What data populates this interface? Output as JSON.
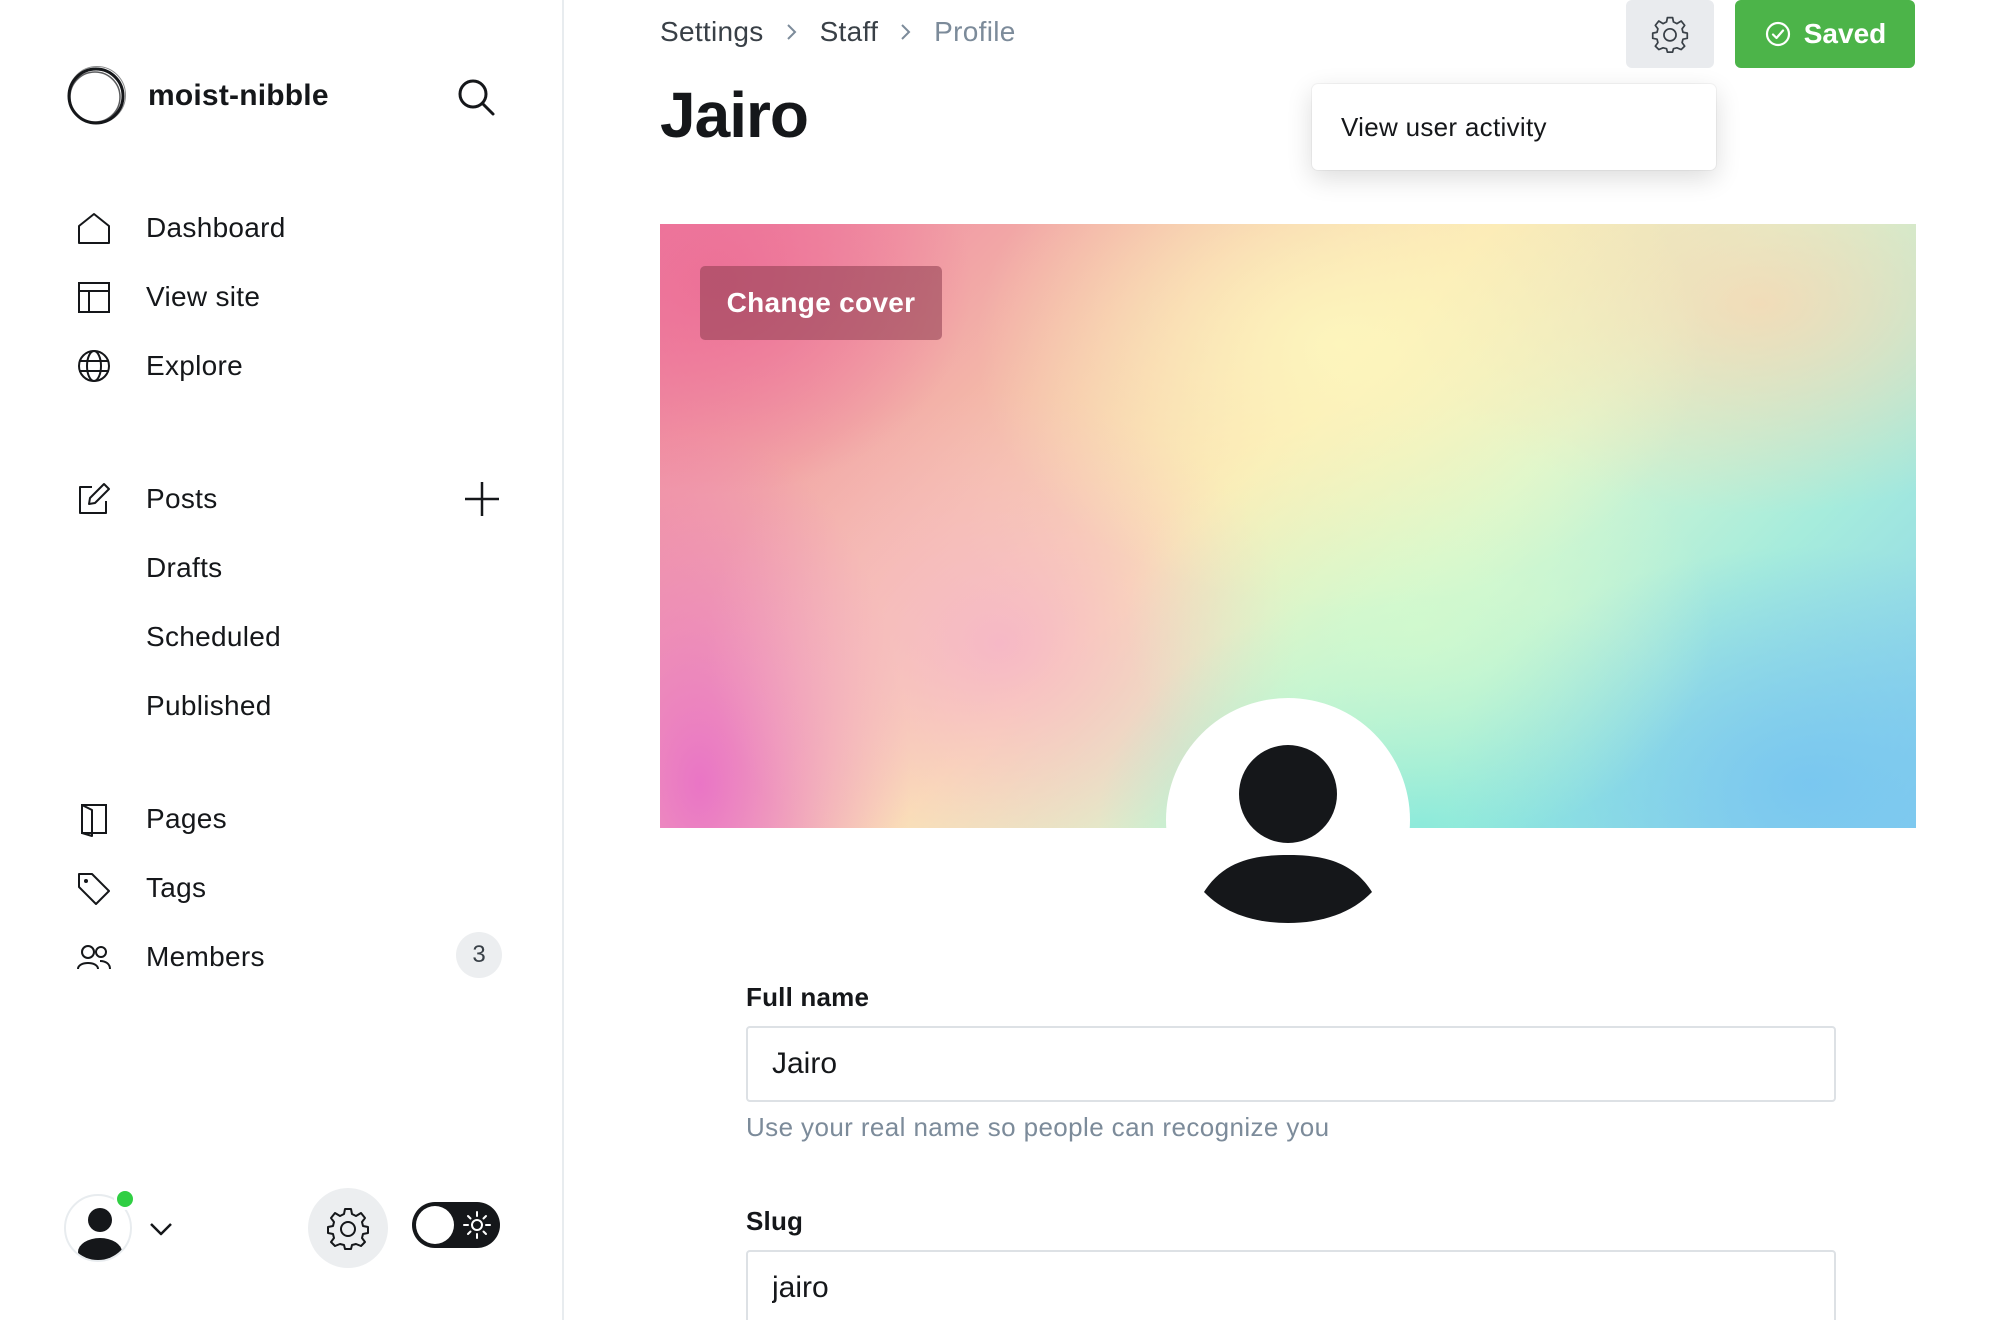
{
  "sidebar": {
    "site_name": "moist-nibble",
    "nav": [
      {
        "label": "Dashboard",
        "icon": "home-icon"
      },
      {
        "label": "View site",
        "icon": "layout-icon"
      },
      {
        "label": "Explore",
        "icon": "globe-icon"
      }
    ],
    "posts": {
      "label": "Posts",
      "sub": [
        "Drafts",
        "Scheduled",
        "Published"
      ]
    },
    "pages_label": "Pages",
    "tags_label": "Tags",
    "members_label": "Members",
    "members_count": "3"
  },
  "header": {
    "breadcrumb": [
      "Settings",
      "Staff",
      "Profile"
    ],
    "title": "Jairo",
    "saved_label": "Saved",
    "menu_item": "View user activity"
  },
  "cover": {
    "change_label": "Change cover"
  },
  "form": {
    "full_name_label": "Full name",
    "full_name_value": "Jairo",
    "full_name_hint": "Use your real name so people can recognize you",
    "slug_label": "Slug",
    "slug_value": "jairo"
  },
  "colors": {
    "accent_green": "#4cb449",
    "presence_green": "#30cf43",
    "text_primary": "#15171a",
    "text_muted": "#7c8b9a"
  }
}
